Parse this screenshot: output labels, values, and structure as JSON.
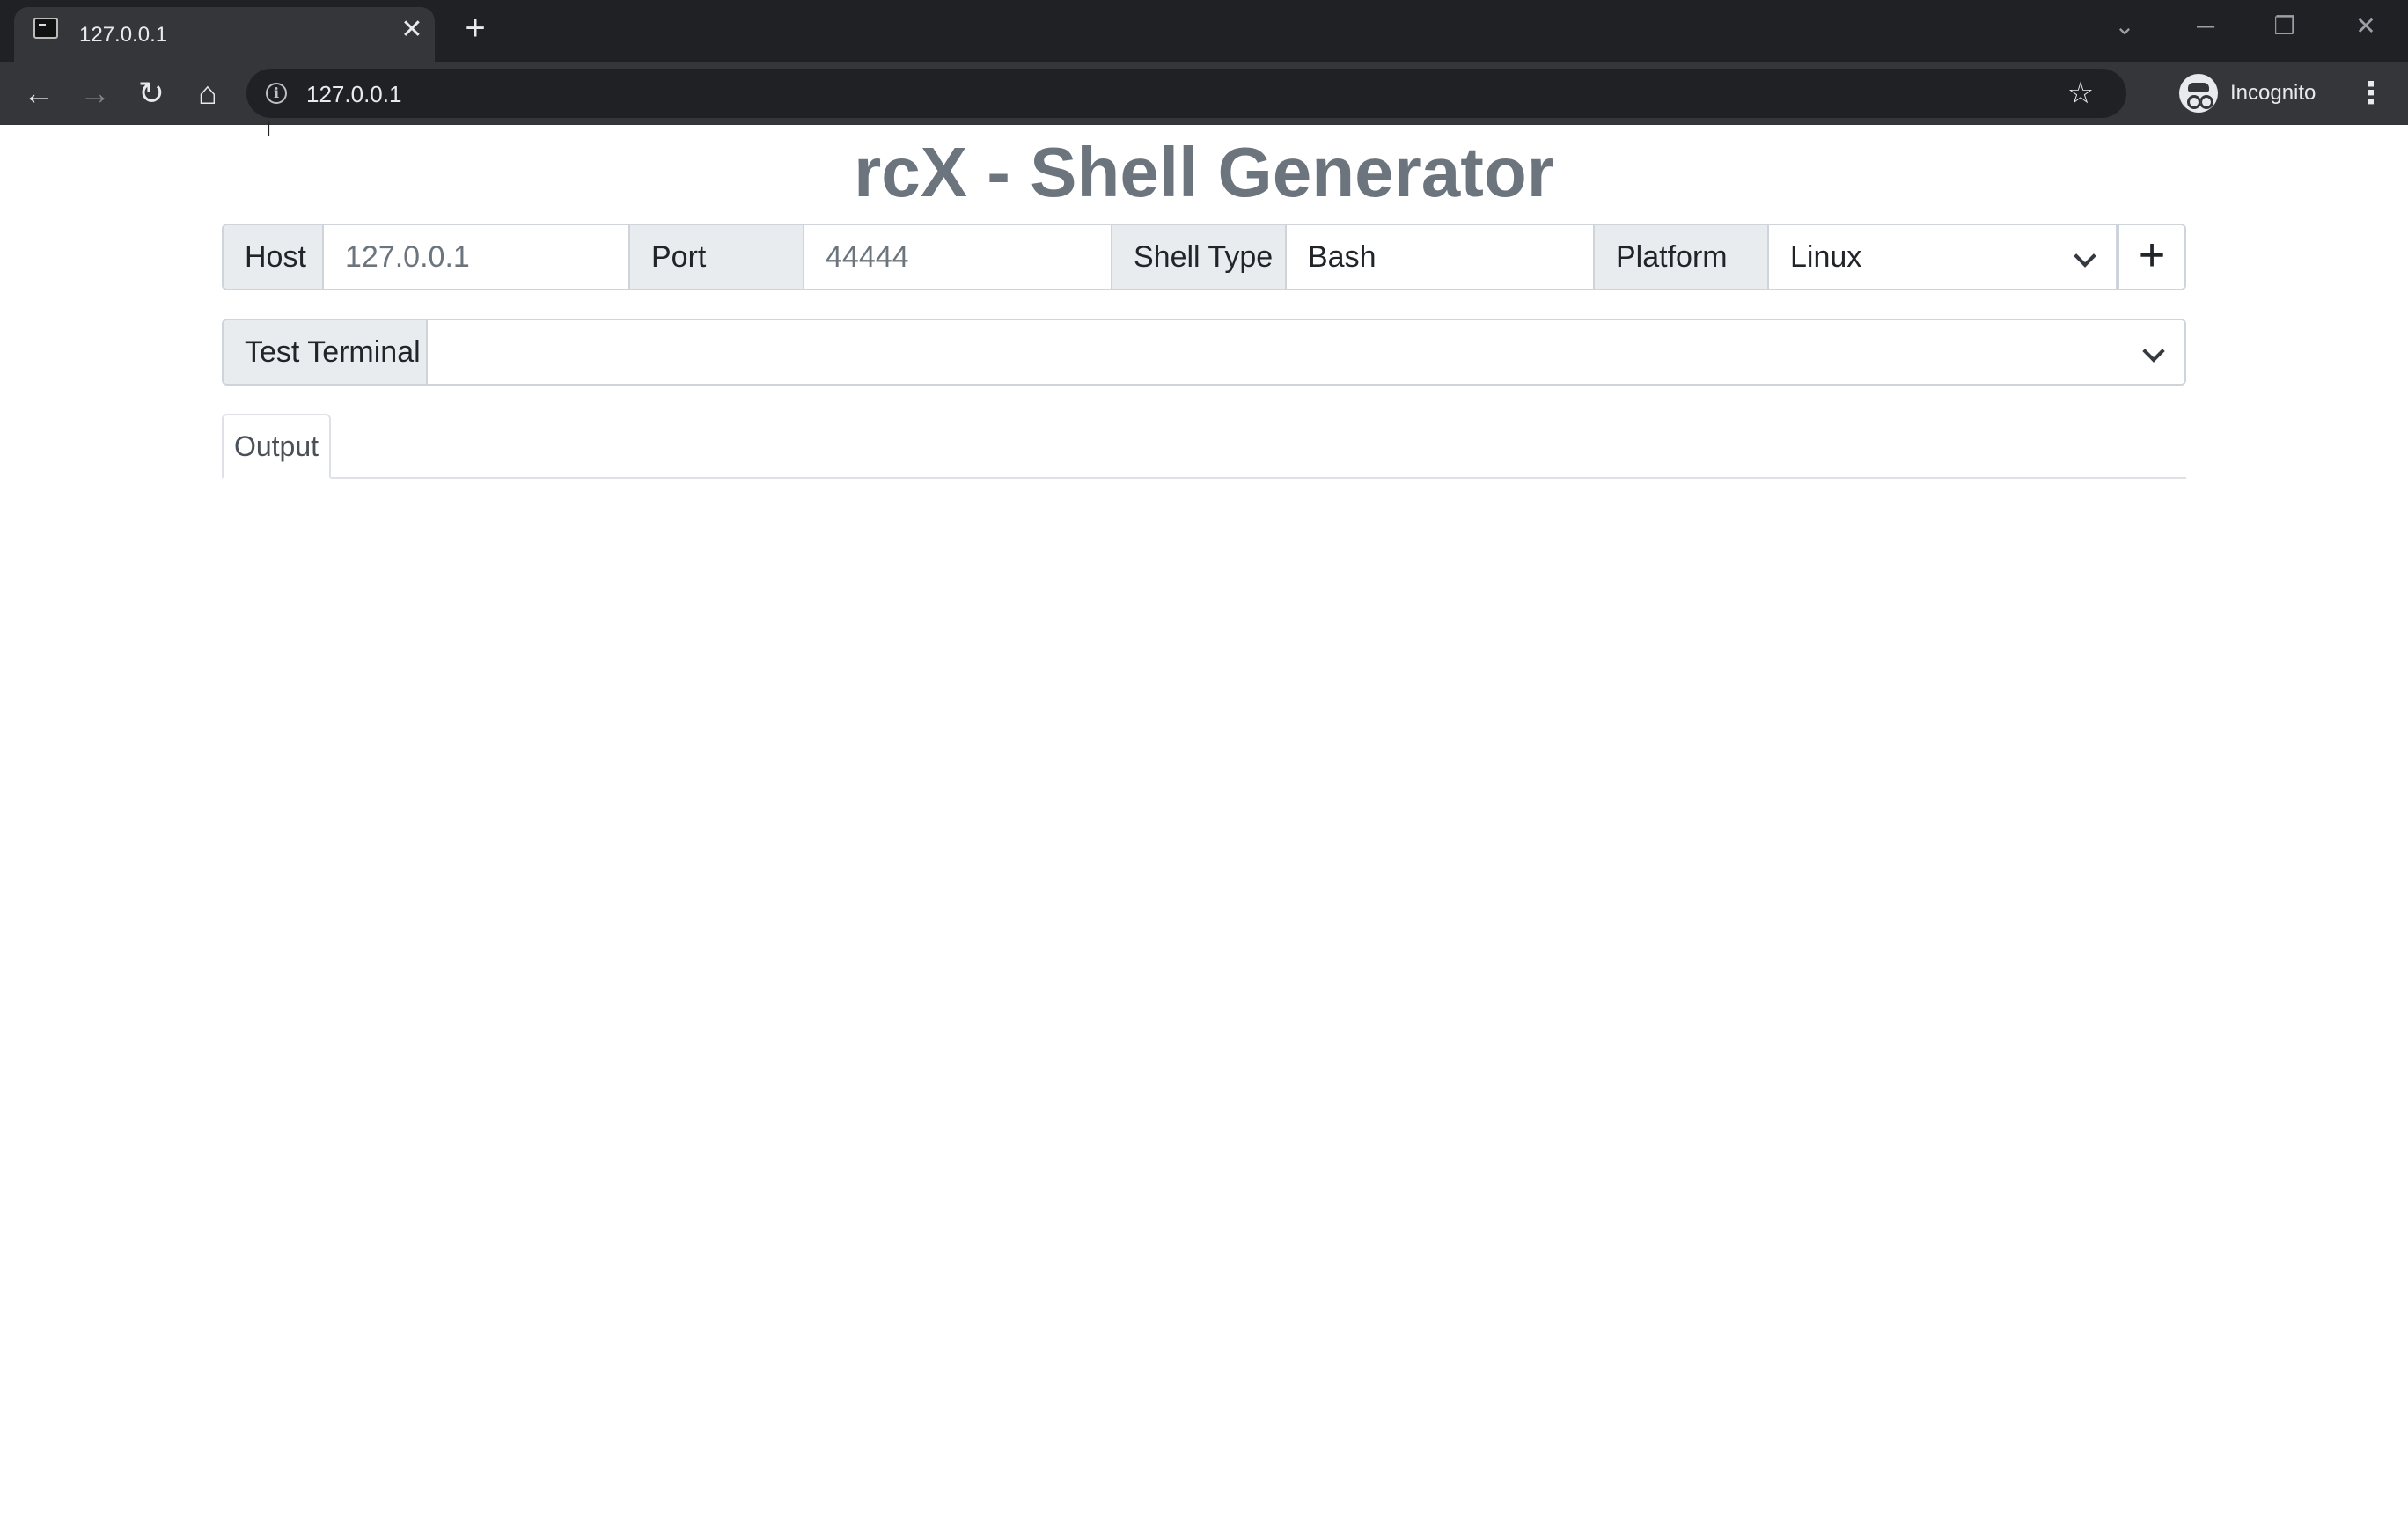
{
  "browser": {
    "tab_title": "127.0.0.1",
    "url": "127.0.0.1",
    "profile_label": "Incognito"
  },
  "page": {
    "title": "rcX - Shell Generator",
    "host": {
      "label": "Host",
      "placeholder": "127.0.0.1"
    },
    "port": {
      "label": "Port",
      "placeholder": "44444"
    },
    "shell_type": {
      "label": "Shell Type",
      "value": "Bash"
    },
    "platform": {
      "label": "Platform",
      "value": "Linux"
    },
    "add_button": "+",
    "test_terminal": {
      "label": "Test Terminal",
      "value": ""
    },
    "tabs": [
      {
        "label": "Output"
      }
    ]
  }
}
